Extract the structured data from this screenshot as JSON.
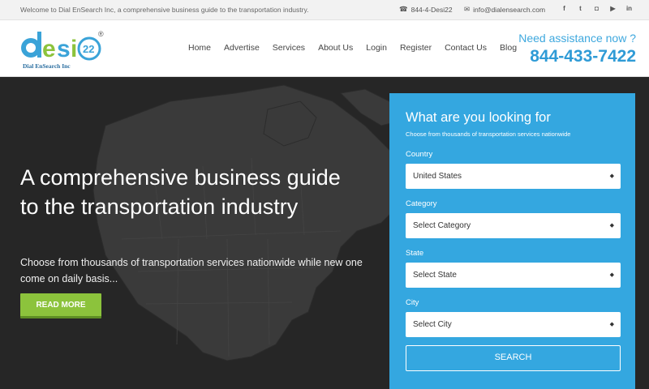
{
  "topbar": {
    "welcome": "Welcome to Dial EnSearch Inc, a comprehensive business guide to the transportation industry.",
    "phone": "844-4-Desi22",
    "email": "info@dialensearch.com",
    "socials": [
      {
        "name": "facebook-icon",
        "glyph": "f"
      },
      {
        "name": "twitter-icon",
        "glyph": "t"
      },
      {
        "name": "instagram-icon",
        "glyph": "◘"
      },
      {
        "name": "youtube-icon",
        "glyph": "▶"
      },
      {
        "name": "linkedin-icon",
        "glyph": "in"
      }
    ]
  },
  "logo": {
    "brand": "desi",
    "badge": "22",
    "registered": "®",
    "tagline": "Dial EnSearch Inc"
  },
  "nav": {
    "items": [
      "Home",
      "Advertise",
      "Services",
      "About Us",
      "Login",
      "Register",
      "Contact Us",
      "Blog"
    ]
  },
  "assist": {
    "question": "Need assistance now ?",
    "number": "844-433-7422"
  },
  "hero": {
    "title": "A comprehensive business guide to the transportation industry",
    "subtitle": "Choose from thousands of transportation services nationwide while new one come on daily basis...",
    "button": "READ MORE"
  },
  "search": {
    "title": "What are you looking for",
    "subtitle": "Choose from thousands of transportation services nationwide",
    "fields": [
      {
        "label": "Country",
        "value": "United States"
      },
      {
        "label": "Category",
        "value": "Select Category"
      },
      {
        "label": "State",
        "value": "Select State"
      },
      {
        "label": "City",
        "value": "Select City"
      }
    ],
    "button": "SEARCH"
  },
  "colors": {
    "accent": "#34a7e0",
    "green": "#8cc33c",
    "hero_bg": "#262626"
  }
}
